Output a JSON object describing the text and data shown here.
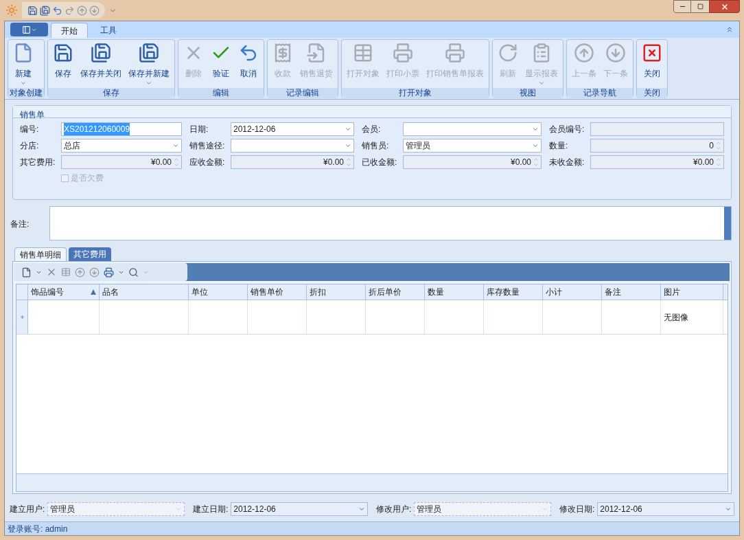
{
  "tabs": [
    {
      "label": "开始",
      "selected": true
    },
    {
      "label": "工具",
      "selected": false
    }
  ],
  "groups": [
    {
      "label": "对象创建",
      "buttons": [
        {
          "label": "新建",
          "disabled": false,
          "dropdown": true
        }
      ]
    },
    {
      "label": "保存",
      "buttons": [
        {
          "label": "保存",
          "disabled": false,
          "dropdown": false
        },
        {
          "label": "保存并关闭",
          "disabled": false,
          "dropdown": false
        },
        {
          "label": "保存并新建",
          "disabled": false,
          "dropdown": true
        }
      ]
    },
    {
      "label": "编辑",
      "buttons": [
        {
          "label": "删除",
          "disabled": true,
          "dropdown": false
        },
        {
          "label": "验证",
          "disabled": false,
          "dropdown": false
        },
        {
          "label": "取消",
          "disabled": false,
          "dropdown": false
        }
      ]
    },
    {
      "label": "记录编辑",
      "buttons": [
        {
          "label": "收款",
          "disabled": true,
          "dropdown": false
        },
        {
          "label": "销售退货",
          "disabled": true,
          "dropdown": false
        }
      ]
    },
    {
      "label": "打开对象",
      "buttons": [
        {
          "label": "打开对象",
          "disabled": true,
          "dropdown": false
        },
        {
          "label": "打印小票",
          "disabled": true,
          "dropdown": false
        },
        {
          "label": "打印销售单报表",
          "disabled": true,
          "dropdown": false
        }
      ]
    },
    {
      "label": "视图",
      "buttons": [
        {
          "label": "刷新",
          "disabled": true,
          "dropdown": false
        },
        {
          "label": "显示报表",
          "disabled": true,
          "dropdown": true
        }
      ]
    },
    {
      "label": "记录导航",
      "buttons": [
        {
          "label": "上一条",
          "disabled": true,
          "dropdown": false
        },
        {
          "label": "下一条",
          "disabled": true,
          "dropdown": false
        }
      ]
    },
    {
      "label": "关闭",
      "buttons": [
        {
          "label": "关闭",
          "disabled": false,
          "dropdown": false
        }
      ]
    }
  ],
  "form": {
    "title": "销售单",
    "fields": [
      {
        "label": "编号:",
        "kind": "text",
        "value": "XS201212060009",
        "text_highlighted": true
      },
      {
        "label": "日期:",
        "kind": "combo",
        "value": "2012-12-06",
        "text_highlighted": false
      },
      {
        "label": "会员:",
        "kind": "combo"
      },
      {
        "label": "会员编号:",
        "kind": "readonly"
      },
      {
        "label": "分店:",
        "kind": "combo",
        "value": "总店",
        "text_highlighted": false
      },
      {
        "label": "销售途径:",
        "kind": "combo"
      },
      {
        "label": "销售员:",
        "kind": "combo",
        "value": "管理员",
        "text_highlighted": false
      },
      {
        "label": "数量:",
        "kind": "spin",
        "value": "0",
        "text_highlighted": false
      },
      {
        "label": "其它费用:",
        "kind": "spin",
        "value": "¥0.00",
        "text_highlighted": false
      },
      {
        "label": "应收金额:",
        "kind": "spin",
        "value": "¥0.00",
        "text_highlighted": false
      },
      {
        "label": "已收金额:",
        "kind": "spin",
        "value": "¥0.00",
        "text_highlighted": false
      },
      {
        "label": "未收金额:",
        "kind": "spin",
        "value": "¥0.00",
        "text_highlighted": false
      }
    ],
    "checkbox": {
      "label": "是否欠费",
      "checked": false,
      "disabled": true
    }
  },
  "remark": {
    "label": "备注:"
  },
  "detail_tabs": [
    {
      "label": "销售单明细",
      "selected": true
    },
    {
      "label": "其它费用",
      "selected": false
    }
  ],
  "grid": {
    "columns": [
      {
        "label": "饰品编号",
        "sorted": true
      },
      {
        "label": "品名",
        "sorted": false
      },
      {
        "label": "单位",
        "sorted": false
      },
      {
        "label": "销售单价",
        "sorted": false
      },
      {
        "label": "折扣",
        "sorted": false
      },
      {
        "label": "折后单价",
        "sorted": false
      },
      {
        "label": "数量",
        "sorted": false
      },
      {
        "label": "库存数量",
        "sorted": false
      },
      {
        "label": "小计",
        "sorted": false
      },
      {
        "label": "备注",
        "sorted": false
      },
      {
        "label": "图片",
        "sorted": false
      }
    ],
    "new_row": {
      "picture": "无图像"
    }
  },
  "footer_fields": [
    {
      "label": "建立用户:",
      "value": "管理员",
      "disabled": true
    },
    {
      "label": "建立日期:",
      "value": "2012-12-06",
      "disabled": false
    },
    {
      "label": "修改用户:",
      "value": "管理员",
      "disabled": true
    },
    {
      "label": "修改日期:",
      "value": "2012-12-06",
      "disabled": false
    }
  ],
  "status_bar": "登录账号: admin"
}
